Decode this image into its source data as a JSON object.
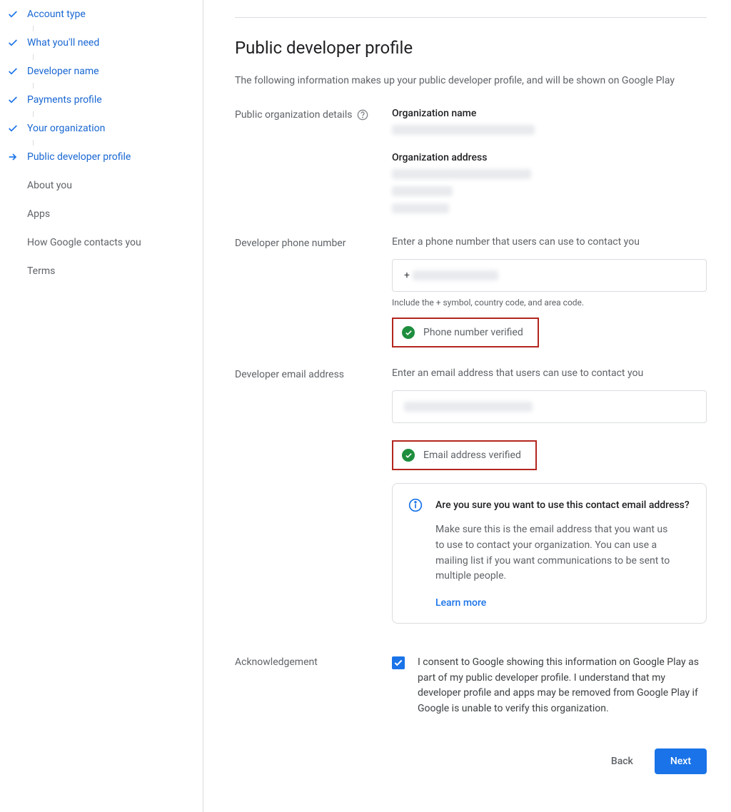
{
  "sidebar": {
    "items": [
      {
        "label": "Account type",
        "state": "done"
      },
      {
        "label": "What you'll need",
        "state": "done"
      },
      {
        "label": "Developer name",
        "state": "done"
      },
      {
        "label": "Payments profile",
        "state": "done"
      },
      {
        "label": "Your organization",
        "state": "done"
      },
      {
        "label": "Public developer profile",
        "state": "current"
      },
      {
        "label": "About you",
        "state": "pending"
      },
      {
        "label": "Apps",
        "state": "pending"
      },
      {
        "label": "How Google contacts you",
        "state": "pending"
      },
      {
        "label": "Terms",
        "state": "pending"
      }
    ]
  },
  "main": {
    "title": "Public developer profile",
    "desc": "The following information makes up your public developer profile, and will be shown on Google Play",
    "org_details_label": "Public organization details",
    "org_name_label": "Organization name",
    "org_address_label": "Organization address",
    "phone": {
      "label": "Developer phone number",
      "hint": "Enter a phone number that users can use to contact you",
      "prefix": "+",
      "sub_hint": "Include the + symbol, country code, and area code.",
      "verified": "Phone number verified"
    },
    "email": {
      "label": "Developer email address",
      "hint": "Enter an email address that users can use to contact you",
      "verified": "Email address verified"
    },
    "info": {
      "title": "Are you sure you want to use this contact email address?",
      "body": "Make sure this is the email address that you want us to use to contact your organization. You can use a mailing list if you want communications to be sent to multiple people.",
      "link": "Learn more"
    },
    "ack": {
      "label": "Acknowledgement",
      "text": "I consent to Google showing this information on Google Play as part of my public developer profile. I understand that my developer profile and apps may be removed from Google Play if Google is unable to verify this organization."
    },
    "buttons": {
      "back": "Back",
      "next": "Next"
    }
  }
}
